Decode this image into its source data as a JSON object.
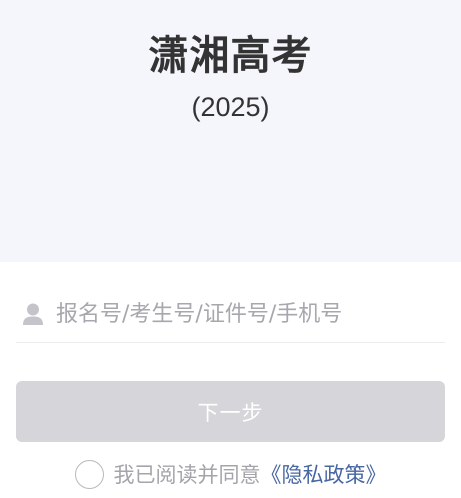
{
  "header": {
    "title": "潇湘高考",
    "subtitle": "(2025)"
  },
  "form": {
    "account_placeholder": "报名号/考生号/证件号/手机号",
    "account_icon": "user-icon",
    "next_button_label": "下一步",
    "agree_text": "我已阅读并同意",
    "policy_link": "《隐私政策》",
    "agree_checked": false
  },
  "colors": {
    "hero_background": "#f5f6fb",
    "button_disabled": "#d5d5da",
    "link": "#4767a3"
  }
}
